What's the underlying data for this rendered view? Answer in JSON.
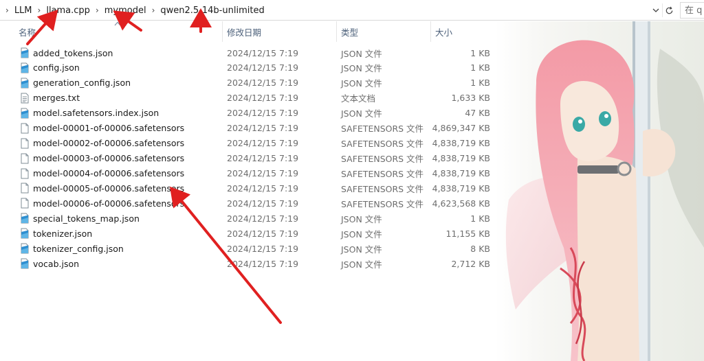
{
  "breadcrumb": {
    "items": [
      "LLM",
      "llama.cpp",
      "mymodel",
      "qwen2.5-14b-unlimited"
    ]
  },
  "search": {
    "placeholder": "在 q"
  },
  "columns": {
    "name": "名称",
    "date": "修改日期",
    "type": "类型",
    "size": "大小"
  },
  "files": [
    {
      "name": "added_tokens.json",
      "date": "2024/12/15 7:19",
      "type": "JSON 文件",
      "size": "1 KB",
      "icon": "json-file-icon"
    },
    {
      "name": "config.json",
      "date": "2024/12/15 7:19",
      "type": "JSON 文件",
      "size": "1 KB",
      "icon": "json-file-icon"
    },
    {
      "name": "generation_config.json",
      "date": "2024/12/15 7:19",
      "type": "JSON 文件",
      "size": "1 KB",
      "icon": "json-file-icon"
    },
    {
      "name": "merges.txt",
      "date": "2024/12/15 7:19",
      "type": "文本文档",
      "size": "1,633 KB",
      "icon": "text-file-icon"
    },
    {
      "name": "model.safetensors.index.json",
      "date": "2024/12/15 7:19",
      "type": "JSON 文件",
      "size": "47 KB",
      "icon": "json-file-icon"
    },
    {
      "name": "model-00001-of-00006.safetensors",
      "date": "2024/12/15 7:19",
      "type": "SAFETENSORS 文件",
      "size": "4,869,347 KB",
      "icon": "blank-file-icon"
    },
    {
      "name": "model-00002-of-00006.safetensors",
      "date": "2024/12/15 7:19",
      "type": "SAFETENSORS 文件",
      "size": "4,838,719 KB",
      "icon": "blank-file-icon"
    },
    {
      "name": "model-00003-of-00006.safetensors",
      "date": "2024/12/15 7:19",
      "type": "SAFETENSORS 文件",
      "size": "4,838,719 KB",
      "icon": "blank-file-icon"
    },
    {
      "name": "model-00004-of-00006.safetensors",
      "date": "2024/12/15 7:19",
      "type": "SAFETENSORS 文件",
      "size": "4,838,719 KB",
      "icon": "blank-file-icon"
    },
    {
      "name": "model-00005-of-00006.safetensors",
      "date": "2024/12/15 7:19",
      "type": "SAFETENSORS 文件",
      "size": "4,838,719 KB",
      "icon": "blank-file-icon"
    },
    {
      "name": "model-00006-of-00006.safetensors",
      "date": "2024/12/15 7:19",
      "type": "SAFETENSORS 文件",
      "size": "4,623,568 KB",
      "icon": "blank-file-icon"
    },
    {
      "name": "special_tokens_map.json",
      "date": "2024/12/15 7:19",
      "type": "JSON 文件",
      "size": "1 KB",
      "icon": "json-file-icon"
    },
    {
      "name": "tokenizer.json",
      "date": "2024/12/15 7:19",
      "type": "JSON 文件",
      "size": "11,155 KB",
      "icon": "json-file-icon"
    },
    {
      "name": "tokenizer_config.json",
      "date": "2024/12/15 7:19",
      "type": "JSON 文件",
      "size": "8 KB",
      "icon": "json-file-icon"
    },
    {
      "name": "vocab.json",
      "date": "2024/12/15 7:19",
      "type": "JSON 文件",
      "size": "2,712 KB",
      "icon": "json-file-icon"
    }
  ],
  "colors": {
    "header_text": "#4c607a",
    "secondary_text": "#6d6d6d",
    "annotation_arrow": "#e02020"
  }
}
